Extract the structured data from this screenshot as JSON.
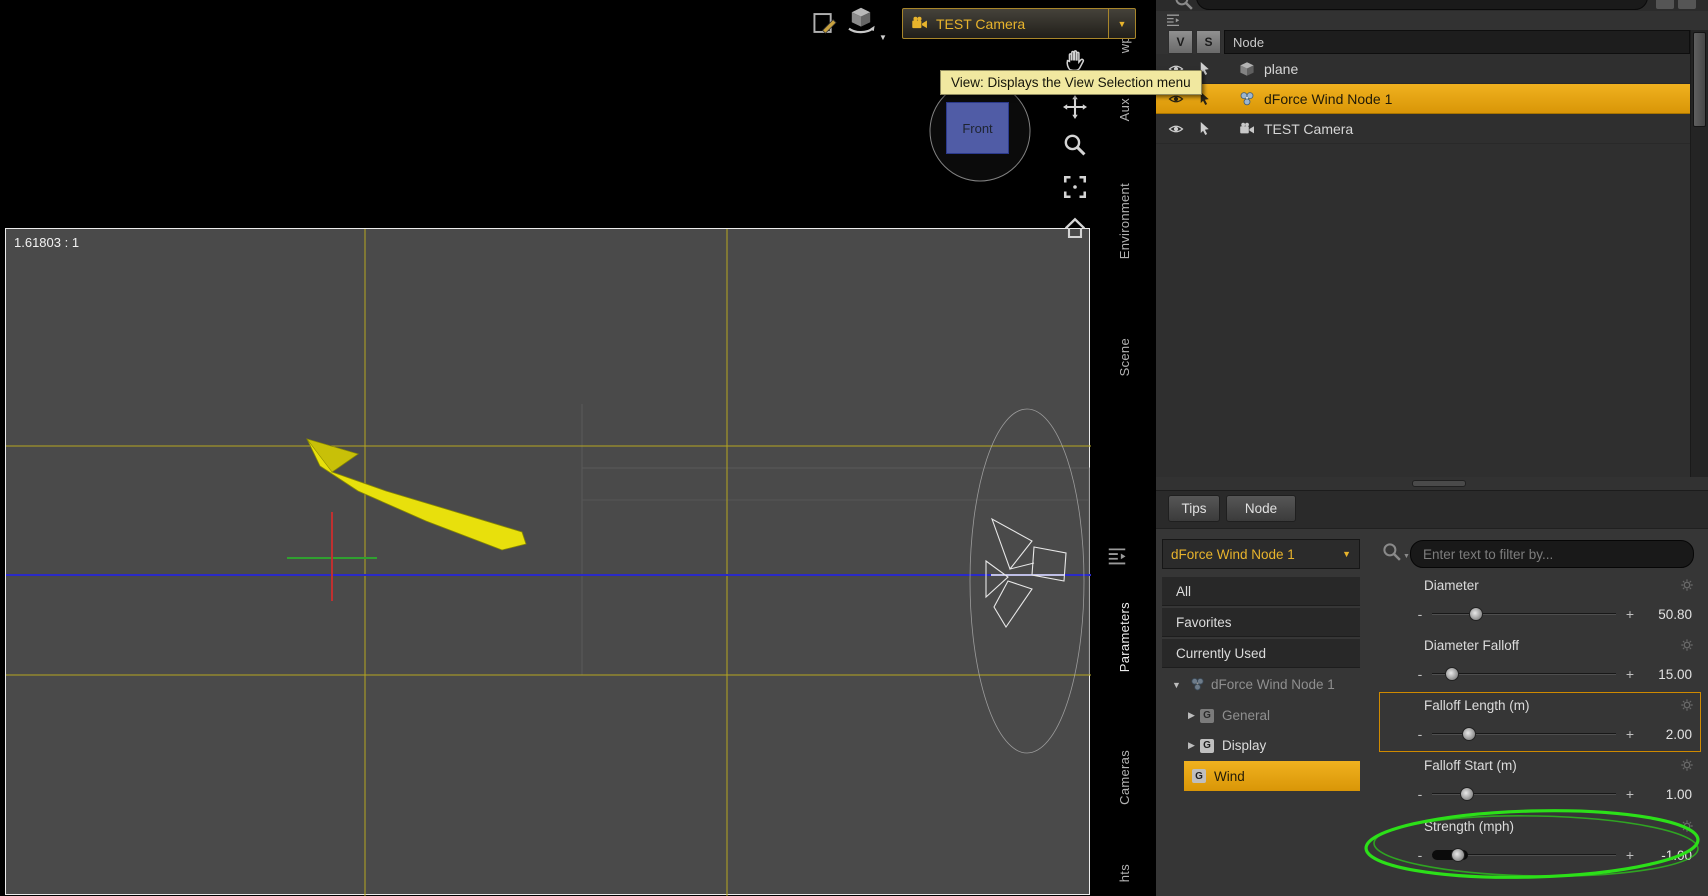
{
  "viewport": {
    "ratio_label": "1.61803 : 1",
    "view_cube_label": "Front"
  },
  "toolbar": {
    "camera_selector_label": "TEST Camera"
  },
  "tooltip_text": "View: Displays the View Selection menu",
  "dock_tabs": {
    "top": [
      "wport",
      "Aux",
      "Environment",
      "Scene"
    ],
    "bottom": [
      "Parameters",
      "Cameras",
      "hts"
    ]
  },
  "scene_panel": {
    "header": {
      "v": "V",
      "s": "S",
      "node": "Node"
    },
    "items": [
      {
        "label": "plane",
        "type": "mesh"
      },
      {
        "label": "dForce Wind Node 1",
        "type": "wind-node",
        "selected": true
      },
      {
        "label": "TEST Camera",
        "type": "camera"
      }
    ]
  },
  "bottom_pane_tabs": {
    "tips": "Tips",
    "node": "Node"
  },
  "parameters_panel": {
    "node_selector_label": "dForce Wind Node 1",
    "filter_placeholder": "Enter text to filter by...",
    "groups": [
      {
        "label": "All"
      },
      {
        "label": "Favorites"
      },
      {
        "label": "Currently Used"
      }
    ],
    "tree_root_label": "dForce Wind Node 1",
    "tree_children": [
      {
        "label": "General",
        "dimmed": true
      },
      {
        "label": "Display",
        "dimmed": false
      },
      {
        "label": "Wind",
        "selected": true
      }
    ],
    "minus_label": "-",
    "plus_label": "+",
    "sliders": [
      {
        "label": "Diameter",
        "value": "50.80",
        "handle_pct": 24,
        "highlighted": false,
        "dark_fill": false,
        "circled": false
      },
      {
        "label": "Diameter Falloff",
        "value": "15.00",
        "handle_pct": 11,
        "highlighted": false,
        "dark_fill": false,
        "circled": false
      },
      {
        "label": "Falloff Length (m)",
        "value": "2.00",
        "handle_pct": 20,
        "highlighted": true,
        "dark_fill": false,
        "circled": false
      },
      {
        "label": "Falloff Start (m)",
        "value": "1.00",
        "handle_pct": 19,
        "highlighted": false,
        "dark_fill": false,
        "circled": false
      },
      {
        "label": "Strength (mph)",
        "value": "-1.00",
        "handle_pct": 14,
        "highlighted": false,
        "dark_fill": true,
        "circled": true
      }
    ]
  },
  "icons": {
    "chevron_down": "▼",
    "chevron_right": "▶",
    "group_letter": "G"
  },
  "colors": {
    "selection_orange": "#e8a114",
    "accent_yellow": "#e8b42c",
    "annotation_green": "#2ce019",
    "highlight_border": "#cf8a00"
  }
}
